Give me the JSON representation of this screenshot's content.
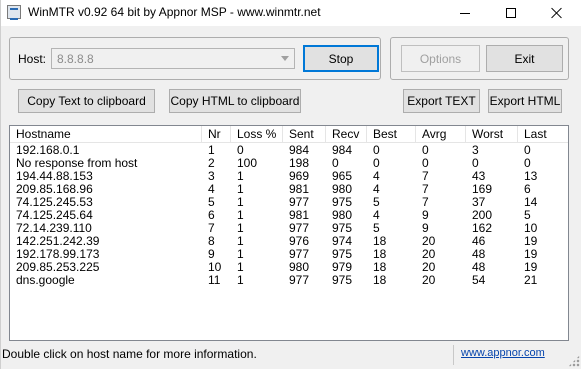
{
  "window": {
    "title": "WinMTR v0.92 64 bit by Appnor MSP - www.winmtr.net"
  },
  "host": {
    "label": "Host:",
    "value": "8.8.8.8"
  },
  "buttons": {
    "stop": "Stop",
    "options": "Options",
    "exit": "Exit",
    "copy_text": "Copy Text to clipboard",
    "copy_html": "Copy HTML to clipboard",
    "export_text": "Export TEXT",
    "export_html": "Export HTML"
  },
  "table": {
    "columns": [
      "Hostname",
      "Nr",
      "Loss %",
      "Sent",
      "Recv",
      "Best",
      "Avrg",
      "Worst",
      "Last"
    ],
    "rows": [
      [
        "192.168.0.1",
        "1",
        "0",
        "984",
        "984",
        "0",
        "0",
        "3",
        "0"
      ],
      [
        "No response from host",
        "2",
        "100",
        "198",
        "0",
        "0",
        "0",
        "0",
        "0"
      ],
      [
        "194.44.88.153",
        "3",
        "1",
        "969",
        "965",
        "4",
        "7",
        "43",
        "13"
      ],
      [
        "209.85.168.96",
        "4",
        "1",
        "981",
        "980",
        "4",
        "7",
        "169",
        "6"
      ],
      [
        "74.125.245.53",
        "5",
        "1",
        "977",
        "975",
        "5",
        "7",
        "37",
        "14"
      ],
      [
        "74.125.245.64",
        "6",
        "1",
        "981",
        "980",
        "4",
        "9",
        "200",
        "5"
      ],
      [
        "72.14.239.110",
        "7",
        "1",
        "977",
        "975",
        "5",
        "9",
        "162",
        "10"
      ],
      [
        "142.251.242.39",
        "8",
        "1",
        "976",
        "974",
        "18",
        "20",
        "46",
        "19"
      ],
      [
        "192.178.99.173",
        "9",
        "1",
        "977",
        "975",
        "18",
        "20",
        "48",
        "19"
      ],
      [
        "209.85.253.225",
        "10",
        "1",
        "980",
        "979",
        "18",
        "20",
        "48",
        "19"
      ],
      [
        "dns.google",
        "11",
        "1",
        "977",
        "975",
        "18",
        "20",
        "54",
        "21"
      ]
    ]
  },
  "status": {
    "text": "Double click on host name for more information.",
    "link": "www.appnor.com"
  },
  "colors": {
    "accent": "#0078d7",
    "link": "#0645ad"
  }
}
